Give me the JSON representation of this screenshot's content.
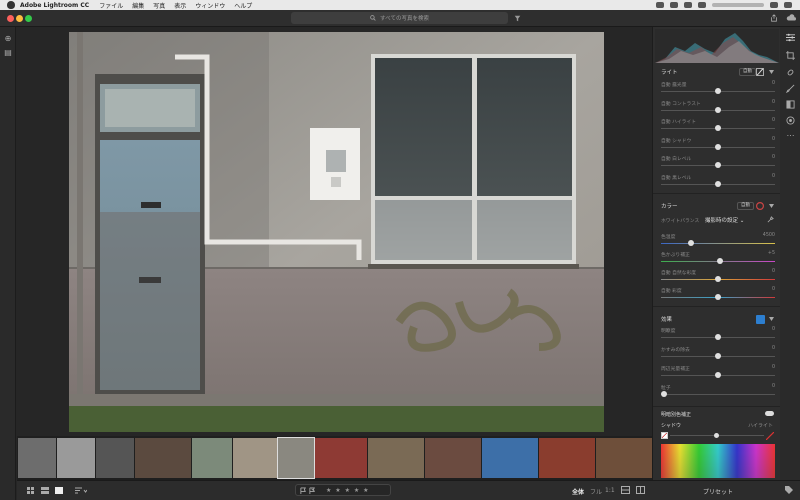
{
  "menubar": {
    "app_name": "Adobe Lightroom CC",
    "items": [
      "ファイル",
      "編集",
      "写真",
      "表示",
      "ウィンドウ",
      "ヘルプ"
    ]
  },
  "search": {
    "placeholder": "すべての写真を検索"
  },
  "light": {
    "title": "ライト",
    "auto_label": "自動",
    "sliders": [
      {
        "label": "自動 露光量",
        "value": "0",
        "level": 0.5
      },
      {
        "label": "自動 コントラスト",
        "value": "0",
        "level": 0.5
      },
      {
        "label": "自動 ハイライト",
        "value": "0",
        "level": 0.5
      },
      {
        "label": "自動 シャドウ",
        "value": "0",
        "level": 0.5
      },
      {
        "label": "自動 白レベル",
        "value": "0",
        "level": 0.5
      },
      {
        "label": "自動 黒レベル",
        "value": "0",
        "level": 0.5
      }
    ]
  },
  "color": {
    "title": "カラー",
    "auto_label": "自動",
    "wb_label": "ホワイトバランス",
    "wb_value": "撮影時の設定",
    "sliders": [
      {
        "label": "色温度",
        "value": "4500",
        "level": 0.25
      },
      {
        "label": "色かぶり補正",
        "value": "+5",
        "level": 0.52
      },
      {
        "label": "自動 自然な彩度",
        "value": "0",
        "level": 0.5
      },
      {
        "label": "自動 彩度",
        "value": "0",
        "level": 0.5
      }
    ]
  },
  "effects": {
    "title": "効果",
    "sliders": [
      {
        "label": "明瞭度",
        "value": "0",
        "level": 0.5
      },
      {
        "label": "かすみの除去",
        "value": "0",
        "level": 0.5
      },
      {
        "label": "周辺光量補正",
        "value": "0",
        "level": 0.5
      },
      {
        "label": "粒子",
        "value": "0",
        "level": 0.0
      }
    ]
  },
  "split_toning": {
    "title": "明暗別色補正",
    "shadow_label": "シャドウ",
    "highlight_label": "ハイライト"
  },
  "bottombar": {
    "rating_stars": "★ ★ ★ ★ ★",
    "zoom_all": "全体",
    "zoom_full": "フル",
    "zoom_1to1": "1:1",
    "presets_label": "プリセット"
  }
}
